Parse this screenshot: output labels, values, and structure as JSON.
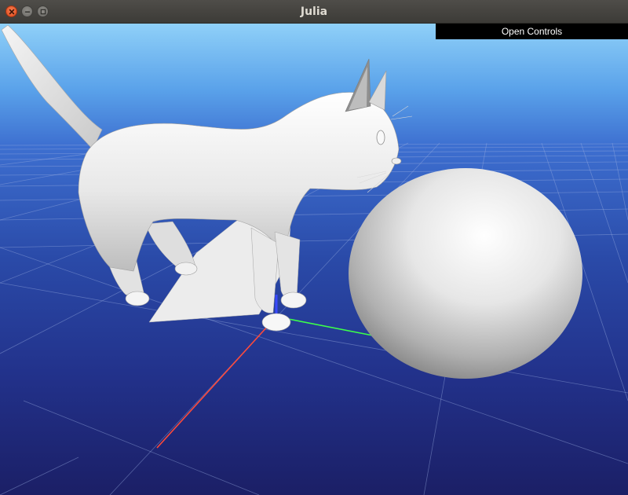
{
  "window": {
    "title": "Julia"
  },
  "controls": {
    "open_label": "Open Controls"
  },
  "scene": {
    "objects": [
      "cat",
      "sphere"
    ],
    "axes_colors": {
      "x": "#ff4a3a",
      "y": "#3cff4a",
      "z": "#3a4aff"
    },
    "sky_top": "#8fd0f8",
    "ground_color": "#2a3f9c",
    "mesh_color": "#f2f2f2"
  }
}
